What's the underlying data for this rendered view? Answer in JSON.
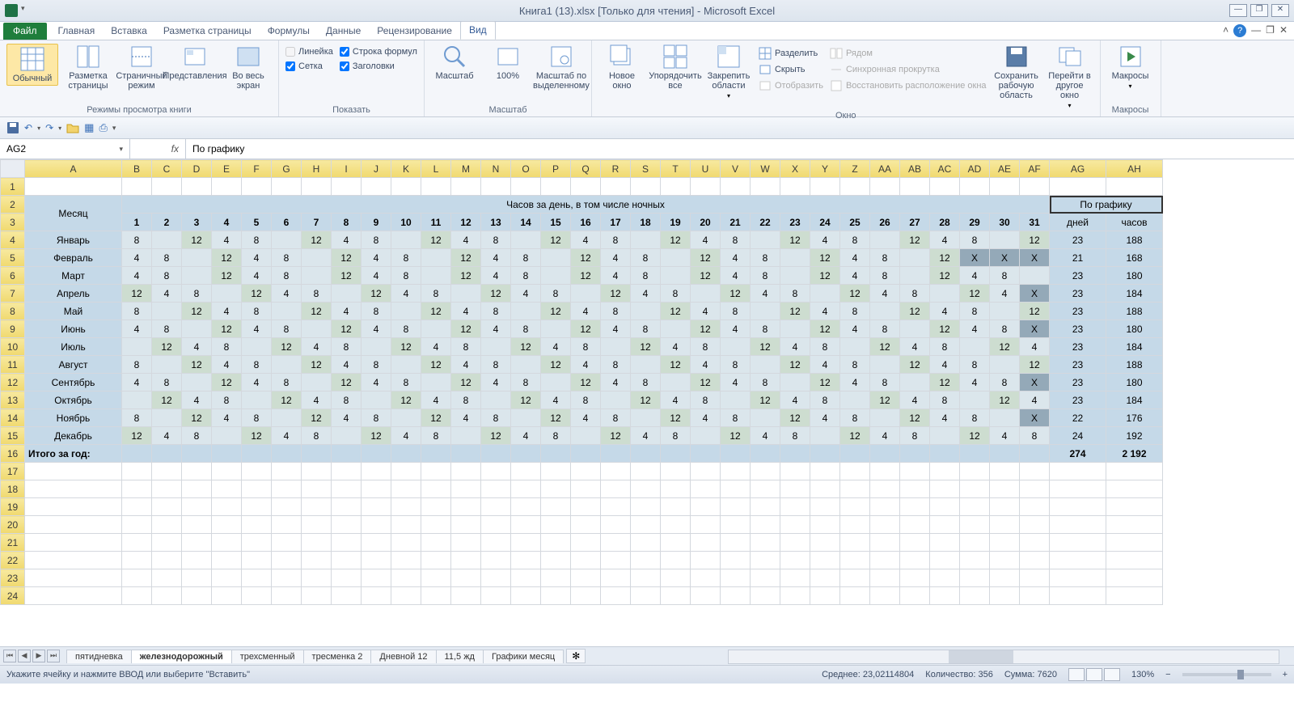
{
  "title": "Книга1 (13).xlsx  [Только для чтения] - Microsoft Excel",
  "tabs": {
    "file": "Файл",
    "home": "Главная",
    "insert": "Вставка",
    "layout": "Разметка страницы",
    "formulas": "Формулы",
    "data": "Данные",
    "review": "Рецензирование",
    "view": "Вид"
  },
  "ribbon": {
    "views": {
      "normal": "Обычный",
      "page": "Разметка страницы",
      "break": "Страничный режим",
      "custom": "Представления",
      "full": "Во весь экран",
      "group": "Режимы просмотра книги"
    },
    "show": {
      "ruler": "Линейка",
      "formula": "Строка формул",
      "grid": "Сетка",
      "headings": "Заголовки",
      "group": "Показать"
    },
    "zoom": {
      "zoom": "Масштаб",
      "z100": "100%",
      "sel": "Масштаб по выделенному",
      "group": "Масштаб"
    },
    "window": {
      "new": "Новое окно",
      "arrange": "Упорядочить все",
      "freeze": "Закрепить области",
      "split": "Разделить",
      "hide": "Скрыть",
      "unhide": "Отобразить",
      "side": "Рядом",
      "sync": "Синхронная прокрутка",
      "reset": "Восстановить расположение окна",
      "save": "Сохранить рабочую область",
      "switch": "Перейти в другое окно",
      "group": "Окно"
    },
    "macros": {
      "macros": "Макросы",
      "group": "Макросы"
    }
  },
  "nameBox": "AG2",
  "formula": "По графику",
  "cols": [
    "A",
    "B",
    "C",
    "D",
    "E",
    "F",
    "G",
    "H",
    "I",
    "J",
    "K",
    "L",
    "M",
    "N",
    "O",
    "P",
    "Q",
    "R",
    "S",
    "T",
    "U",
    "V",
    "W",
    "X",
    "Y",
    "Z",
    "AA",
    "AB",
    "AC",
    "AD",
    "AE",
    "AF",
    "AG",
    "AH"
  ],
  "header": {
    "month": "Месяц",
    "hoursPerDay": "Часов за день, в том числе ночных",
    "schedule": "По графику",
    "days": "дней",
    "hours": "часов"
  },
  "dayNums": [
    "1",
    "2",
    "3",
    "4",
    "5",
    "6",
    "7",
    "8",
    "9",
    "10",
    "11",
    "12",
    "13",
    "14",
    "15",
    "16",
    "17",
    "18",
    "19",
    "20",
    "21",
    "22",
    "23",
    "24",
    "25",
    "26",
    "27",
    "28",
    "29",
    "30",
    "31"
  ],
  "months": [
    {
      "name": "Январь",
      "d": [
        "8",
        "",
        "12",
        "4",
        "8",
        "",
        "12",
        "4",
        "8",
        "",
        "12",
        "4",
        "8",
        "",
        "12",
        "4",
        "8",
        "",
        "12",
        "4",
        "8",
        "",
        "12",
        "4",
        "8",
        "",
        "12",
        "4",
        "8",
        "",
        "12"
      ],
      "c": [
        "l",
        "l",
        "g",
        "l",
        "l",
        "l",
        "g",
        "l",
        "l",
        "l",
        "g",
        "l",
        "l",
        "l",
        "g",
        "l",
        "l",
        "l",
        "g",
        "l",
        "l",
        "l",
        "g",
        "l",
        "l",
        "l",
        "g",
        "l",
        "l",
        "l",
        "g"
      ],
      "days": "23",
      "hours": "188"
    },
    {
      "name": "Февраль",
      "d": [
        "4",
        "8",
        "",
        "12",
        "4",
        "8",
        "",
        "12",
        "4",
        "8",
        "",
        "12",
        "4",
        "8",
        "",
        "12",
        "4",
        "8",
        "",
        "12",
        "4",
        "8",
        "",
        "12",
        "4",
        "8",
        "",
        "12",
        "X",
        "X",
        "X"
      ],
      "c": [
        "l",
        "l",
        "l",
        "g",
        "l",
        "l",
        "l",
        "g",
        "l",
        "l",
        "l",
        "g",
        "l",
        "l",
        "l",
        "g",
        "l",
        "l",
        "l",
        "g",
        "l",
        "l",
        "l",
        "g",
        "l",
        "l",
        "l",
        "g",
        "d",
        "d",
        "d"
      ],
      "days": "21",
      "hours": "168"
    },
    {
      "name": "Март",
      "d": [
        "4",
        "8",
        "",
        "12",
        "4",
        "8",
        "",
        "12",
        "4",
        "8",
        "",
        "12",
        "4",
        "8",
        "",
        "12",
        "4",
        "8",
        "",
        "12",
        "4",
        "8",
        "",
        "12",
        "4",
        "8",
        "",
        "12",
        "4",
        "8",
        ""
      ],
      "c": [
        "l",
        "l",
        "l",
        "g",
        "l",
        "l",
        "l",
        "g",
        "l",
        "l",
        "l",
        "g",
        "l",
        "l",
        "l",
        "g",
        "l",
        "l",
        "l",
        "g",
        "l",
        "l",
        "l",
        "g",
        "l",
        "l",
        "l",
        "g",
        "l",
        "l",
        "l"
      ],
      "days": "23",
      "hours": "180"
    },
    {
      "name": "Апрель",
      "d": [
        "12",
        "4",
        "8",
        "",
        "12",
        "4",
        "8",
        "",
        "12",
        "4",
        "8",
        "",
        "12",
        "4",
        "8",
        "",
        "12",
        "4",
        "8",
        "",
        "12",
        "4",
        "8",
        "",
        "12",
        "4",
        "8",
        "",
        "12",
        "4",
        "X"
      ],
      "c": [
        "g",
        "l",
        "l",
        "l",
        "g",
        "l",
        "l",
        "l",
        "g",
        "l",
        "l",
        "l",
        "g",
        "l",
        "l",
        "l",
        "g",
        "l",
        "l",
        "l",
        "g",
        "l",
        "l",
        "l",
        "g",
        "l",
        "l",
        "l",
        "g",
        "l",
        "d"
      ],
      "days": "23",
      "hours": "184"
    },
    {
      "name": "Май",
      "d": [
        "8",
        "",
        "12",
        "4",
        "8",
        "",
        "12",
        "4",
        "8",
        "",
        "12",
        "4",
        "8",
        "",
        "12",
        "4",
        "8",
        "",
        "12",
        "4",
        "8",
        "",
        "12",
        "4",
        "8",
        "",
        "12",
        "4",
        "8",
        "",
        "12"
      ],
      "c": [
        "l",
        "l",
        "g",
        "l",
        "l",
        "l",
        "g",
        "l",
        "l",
        "l",
        "g",
        "l",
        "l",
        "l",
        "g",
        "l",
        "l",
        "l",
        "g",
        "l",
        "l",
        "l",
        "g",
        "l",
        "l",
        "l",
        "g",
        "l",
        "l",
        "l",
        "g"
      ],
      "days": "23",
      "hours": "188"
    },
    {
      "name": "Июнь",
      "d": [
        "4",
        "8",
        "",
        "12",
        "4",
        "8",
        "",
        "12",
        "4",
        "8",
        "",
        "12",
        "4",
        "8",
        "",
        "12",
        "4",
        "8",
        "",
        "12",
        "4",
        "8",
        "",
        "12",
        "4",
        "8",
        "",
        "12",
        "4",
        "8",
        "X"
      ],
      "c": [
        "l",
        "l",
        "l",
        "g",
        "l",
        "l",
        "l",
        "g",
        "l",
        "l",
        "l",
        "g",
        "l",
        "l",
        "l",
        "g",
        "l",
        "l",
        "l",
        "g",
        "l",
        "l",
        "l",
        "g",
        "l",
        "l",
        "l",
        "g",
        "l",
        "l",
        "d"
      ],
      "days": "23",
      "hours": "180"
    },
    {
      "name": "Июль",
      "d": [
        "",
        "12",
        "4",
        "8",
        "",
        "12",
        "4",
        "8",
        "",
        "12",
        "4",
        "8",
        "",
        "12",
        "4",
        "8",
        "",
        "12",
        "4",
        "8",
        "",
        "12",
        "4",
        "8",
        "",
        "12",
        "4",
        "8",
        "",
        "12",
        "4"
      ],
      "c": [
        "l",
        "g",
        "l",
        "l",
        "l",
        "g",
        "l",
        "l",
        "l",
        "g",
        "l",
        "l",
        "l",
        "g",
        "l",
        "l",
        "l",
        "g",
        "l",
        "l",
        "l",
        "g",
        "l",
        "l",
        "l",
        "g",
        "l",
        "l",
        "l",
        "g",
        "l"
      ],
      "days": "23",
      "hours": "184"
    },
    {
      "name": "Август",
      "d": [
        "8",
        "",
        "12",
        "4",
        "8",
        "",
        "12",
        "4",
        "8",
        "",
        "12",
        "4",
        "8",
        "",
        "12",
        "4",
        "8",
        "",
        "12",
        "4",
        "8",
        "",
        "12",
        "4",
        "8",
        "",
        "12",
        "4",
        "8",
        "",
        "12"
      ],
      "c": [
        "l",
        "l",
        "g",
        "l",
        "l",
        "l",
        "g",
        "l",
        "l",
        "l",
        "g",
        "l",
        "l",
        "l",
        "g",
        "l",
        "l",
        "l",
        "g",
        "l",
        "l",
        "l",
        "g",
        "l",
        "l",
        "l",
        "g",
        "l",
        "l",
        "l",
        "g"
      ],
      "days": "23",
      "hours": "188"
    },
    {
      "name": "Сентябрь",
      "d": [
        "4",
        "8",
        "",
        "12",
        "4",
        "8",
        "",
        "12",
        "4",
        "8",
        "",
        "12",
        "4",
        "8",
        "",
        "12",
        "4",
        "8",
        "",
        "12",
        "4",
        "8",
        "",
        "12",
        "4",
        "8",
        "",
        "12",
        "4",
        "8",
        "X"
      ],
      "c": [
        "l",
        "l",
        "l",
        "g",
        "l",
        "l",
        "l",
        "g",
        "l",
        "l",
        "l",
        "g",
        "l",
        "l",
        "l",
        "g",
        "l",
        "l",
        "l",
        "g",
        "l",
        "l",
        "l",
        "g",
        "l",
        "l",
        "l",
        "g",
        "l",
        "l",
        "d"
      ],
      "days": "23",
      "hours": "180"
    },
    {
      "name": "Октябрь",
      "d": [
        "",
        "12",
        "4",
        "8",
        "",
        "12",
        "4",
        "8",
        "",
        "12",
        "4",
        "8",
        "",
        "12",
        "4",
        "8",
        "",
        "12",
        "4",
        "8",
        "",
        "12",
        "4",
        "8",
        "",
        "12",
        "4",
        "8",
        "",
        "12",
        "4"
      ],
      "c": [
        "l",
        "g",
        "l",
        "l",
        "l",
        "g",
        "l",
        "l",
        "l",
        "g",
        "l",
        "l",
        "l",
        "g",
        "l",
        "l",
        "l",
        "g",
        "l",
        "l",
        "l",
        "g",
        "l",
        "l",
        "l",
        "g",
        "l",
        "l",
        "l",
        "g",
        "l"
      ],
      "days": "23",
      "hours": "184"
    },
    {
      "name": "Ноябрь",
      "d": [
        "8",
        "",
        "12",
        "4",
        "8",
        "",
        "12",
        "4",
        "8",
        "",
        "12",
        "4",
        "8",
        "",
        "12",
        "4",
        "8",
        "",
        "12",
        "4",
        "8",
        "",
        "12",
        "4",
        "8",
        "",
        "12",
        "4",
        "8",
        "",
        "X"
      ],
      "c": [
        "l",
        "l",
        "g",
        "l",
        "l",
        "l",
        "g",
        "l",
        "l",
        "l",
        "g",
        "l",
        "l",
        "l",
        "g",
        "l",
        "l",
        "l",
        "g",
        "l",
        "l",
        "l",
        "g",
        "l",
        "l",
        "l",
        "g",
        "l",
        "l",
        "l",
        "d"
      ],
      "days": "22",
      "hours": "176"
    },
    {
      "name": "Декабрь",
      "d": [
        "12",
        "4",
        "8",
        "",
        "12",
        "4",
        "8",
        "",
        "12",
        "4",
        "8",
        "",
        "12",
        "4",
        "8",
        "",
        "12",
        "4",
        "8",
        "",
        "12",
        "4",
        "8",
        "",
        "12",
        "4",
        "8",
        "",
        "12",
        "4",
        "8"
      ],
      "c": [
        "g",
        "l",
        "l",
        "l",
        "g",
        "l",
        "l",
        "l",
        "g",
        "l",
        "l",
        "l",
        "g",
        "l",
        "l",
        "l",
        "g",
        "l",
        "l",
        "l",
        "g",
        "l",
        "l",
        "l",
        "g",
        "l",
        "l",
        "l",
        "g",
        "l",
        "l"
      ],
      "days": "24",
      "hours": "192"
    }
  ],
  "total": {
    "label": "Итого за год:",
    "days": "274",
    "hours": "2 192"
  },
  "sheets": [
    "пятидневка",
    "железнодорожный",
    "трехсменный",
    "тресменка 2",
    "Дневной 12",
    "11,5 жд",
    "Графики месяц"
  ],
  "activeSheet": 1,
  "status": {
    "ready": "Укажите ячейку и нажмите ВВОД или выберите \"Вставить\"",
    "avg": "Среднее: 23,02114804",
    "count": "Количество: 356",
    "sum": "Сумма: 7620",
    "zoom": "130%"
  }
}
